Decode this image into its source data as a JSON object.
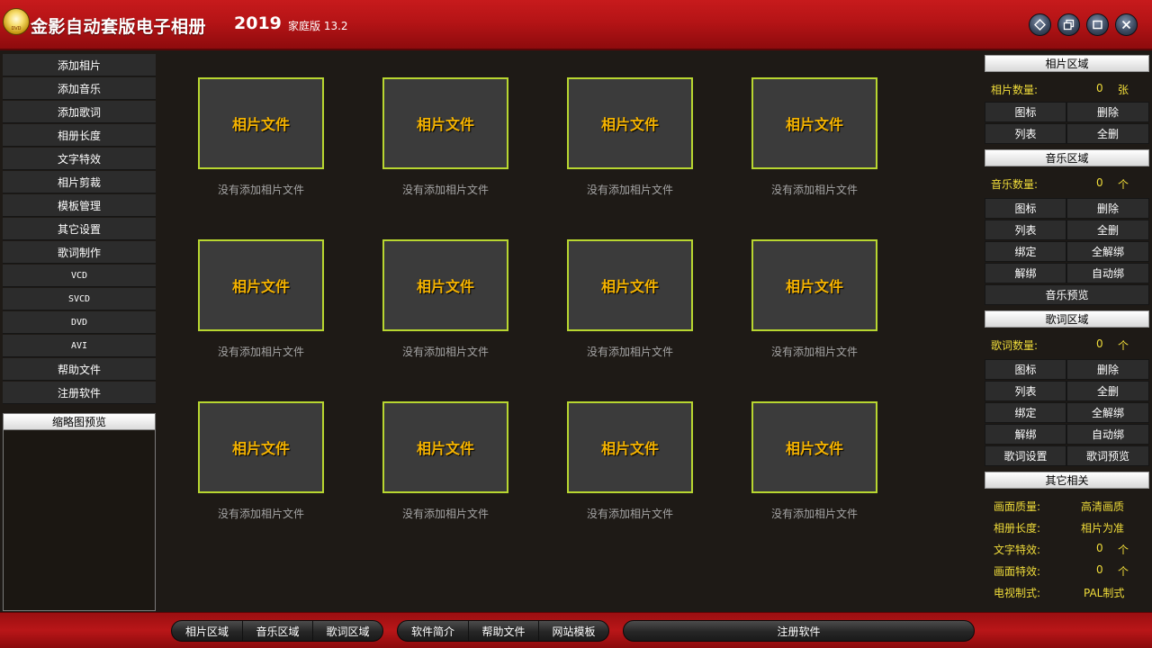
{
  "titlebar": {
    "title": "金影自动套版电子相册",
    "year": "2019",
    "edition": "家庭版 13.2",
    "buttons": [
      "skin-icon",
      "restore-icon",
      "maximize-icon",
      "close-icon"
    ]
  },
  "left_menu": {
    "items": [
      "添加相片",
      "添加音乐",
      "添加歌词",
      "相册长度",
      "文字特效",
      "相片剪裁",
      "模板管理",
      "其它设置",
      "歌词制作",
      "VCD",
      "SVCD",
      "DVD",
      "AVI",
      "帮助文件",
      "注册软件"
    ],
    "thumbnail_header": "缩略图预览"
  },
  "photo_grid": {
    "slot_title": "相片文件",
    "slot_caption": "没有添加相片文件",
    "rows": 3,
    "columns": 4
  },
  "right_panel": {
    "photo": {
      "header": "相片区域",
      "count_label": "相片数量:",
      "count": "0",
      "unit": "张",
      "buttons": [
        [
          "图标",
          "删除"
        ],
        [
          "列表",
          "全删"
        ]
      ]
    },
    "music": {
      "header": "音乐区域",
      "count_label": "音乐数量:",
      "count": "0",
      "unit": "个",
      "buttons": [
        [
          "图标",
          "删除"
        ],
        [
          "列表",
          "全删"
        ],
        [
          "绑定",
          "全解绑"
        ],
        [
          "解绑",
          "自动绑"
        ]
      ],
      "preview": "音乐预览"
    },
    "lyrics": {
      "header": "歌词区域",
      "count_label": "歌词数量:",
      "count": "0",
      "unit": "个",
      "buttons": [
        [
          "图标",
          "删除"
        ],
        [
          "列表",
          "全删"
        ],
        [
          "绑定",
          "全解绑"
        ],
        [
          "解绑",
          "自动绑"
        ],
        [
          "歌词设置",
          "歌词预览"
        ]
      ]
    },
    "other": {
      "header": "其它相关",
      "quality_label": "画面质量:",
      "quality_value": "高清画质",
      "length_label": "相册长度:",
      "length_value": "相片为准",
      "text_fx_label": "文字特效:",
      "text_fx_count": "0",
      "text_fx_unit": "个",
      "scene_fx_label": "画面特效:",
      "scene_fx_count": "0",
      "scene_fx_unit": "个",
      "tv_label": "电视制式:",
      "tv_value": "PAL制式"
    }
  },
  "bottom_bar": {
    "group1": [
      "相片区域",
      "音乐区域",
      "歌词区域"
    ],
    "group2": [
      "软件简介",
      "帮助文件",
      "网站模板"
    ],
    "register": "注册软件"
  },
  "colors": {
    "titlebar_red": "#b51416",
    "slot_border": "#b8d630",
    "slot_title": "#f5b300",
    "info_yellow": "#f1dd3a",
    "background": "#1e1a16"
  }
}
